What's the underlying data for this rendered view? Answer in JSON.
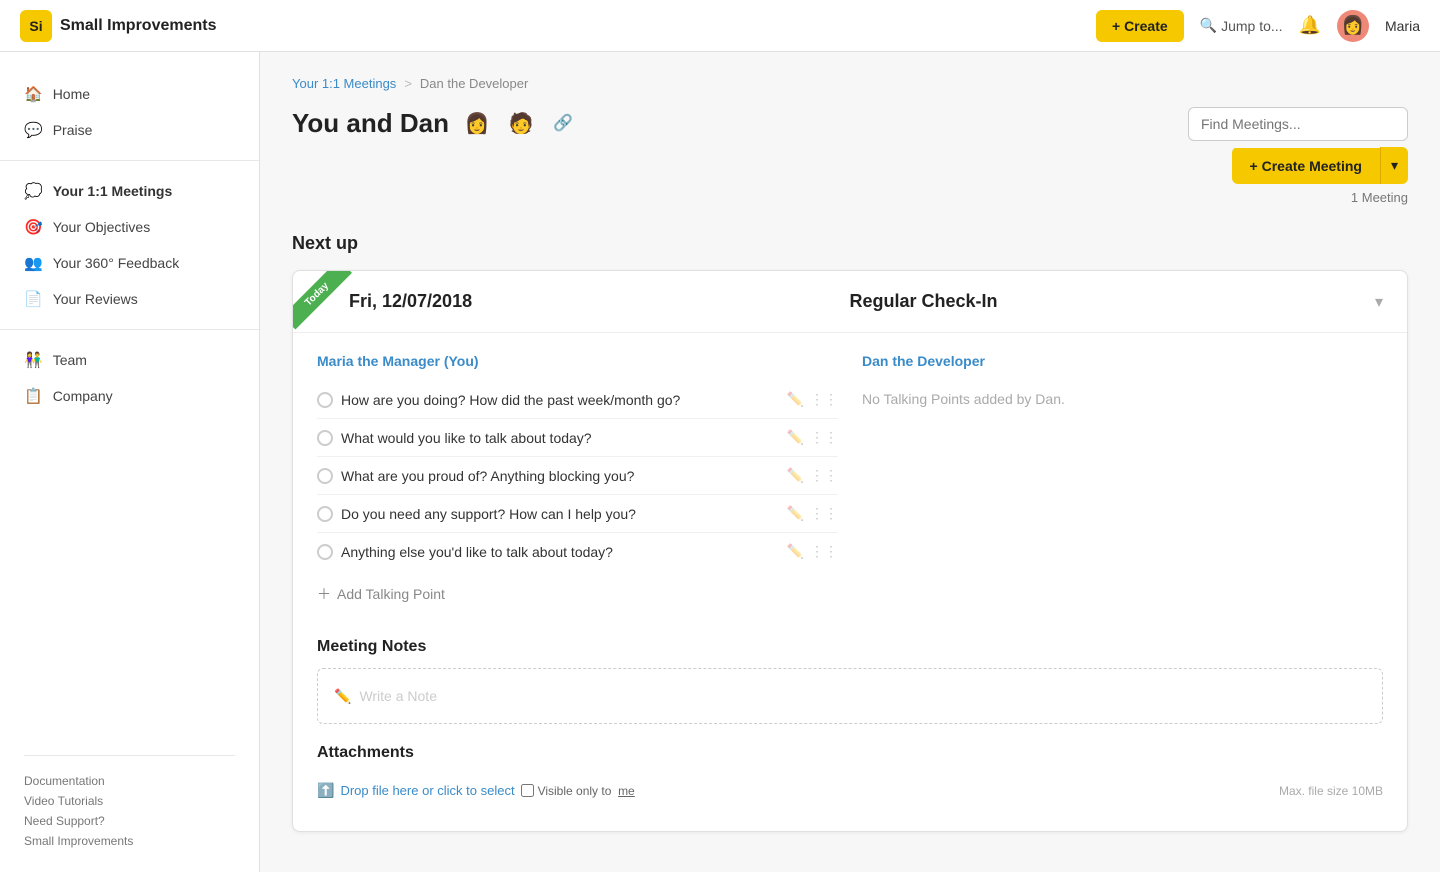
{
  "app": {
    "logo": "Si",
    "brand": "Small Improvements",
    "create_label": "+ Create",
    "jump_label": "Jump to...",
    "user_name": "Maria",
    "user_emoji": "👩"
  },
  "sidebar": {
    "items": [
      {
        "id": "home",
        "label": "Home",
        "icon": "🏠",
        "active": false
      },
      {
        "id": "praise",
        "label": "Praise",
        "icon": "💬",
        "active": false
      },
      {
        "id": "meetings",
        "label": "Your 1:1 Meetings",
        "icon": "💭",
        "active": true
      },
      {
        "id": "objectives",
        "label": "Your Objectives",
        "icon": "🎯",
        "active": false
      },
      {
        "id": "feedback",
        "label": "Your 360° Feedback",
        "icon": "👥",
        "active": false
      },
      {
        "id": "reviews",
        "label": "Your Reviews",
        "icon": "📄",
        "active": false
      },
      {
        "id": "team",
        "label": "Team",
        "icon": "👫",
        "active": false
      },
      {
        "id": "company",
        "label": "Company",
        "icon": "📋",
        "active": false
      }
    ],
    "footer_links": [
      "Documentation",
      "Video Tutorials",
      "Need Support?",
      "Small Improvements"
    ]
  },
  "breadcrumb": {
    "parent_label": "Your 1:1 Meetings",
    "separator": ">",
    "current_label": "Dan the Developer"
  },
  "page": {
    "title": "You and Dan",
    "avatar1": "👩",
    "avatar2": "🧑",
    "find_placeholder": "Find Meetings...",
    "create_meeting_label": "+ Create Meeting",
    "meeting_count": "1 Meeting",
    "section_title": "Next up"
  },
  "meeting": {
    "today_label": "Today",
    "date": "Fri, 12/07/2018",
    "type": "Regular Check-In",
    "manager_name": "Maria the Manager (You)",
    "developer_name": "Dan the Developer",
    "no_talking_points": "No Talking Points added by Dan.",
    "add_talking_point_label": "Add Talking Point",
    "talking_points": [
      "How are you doing? How did the past week/month go?",
      "What would you like to talk about today?",
      "What are you proud of? Anything blocking you?",
      "Do you need any support? How can I help you?",
      "Anything else you'd like to talk about today?"
    ],
    "notes_section_title": "Meeting Notes",
    "notes_placeholder": "Write a Note",
    "attachments_section_title": "Attachments",
    "drop_file_label": "Drop file here or click to select",
    "visible_only_label": "Visible only to",
    "visible_only_me": "me",
    "max_file_size": "Max. file size 10MB"
  }
}
